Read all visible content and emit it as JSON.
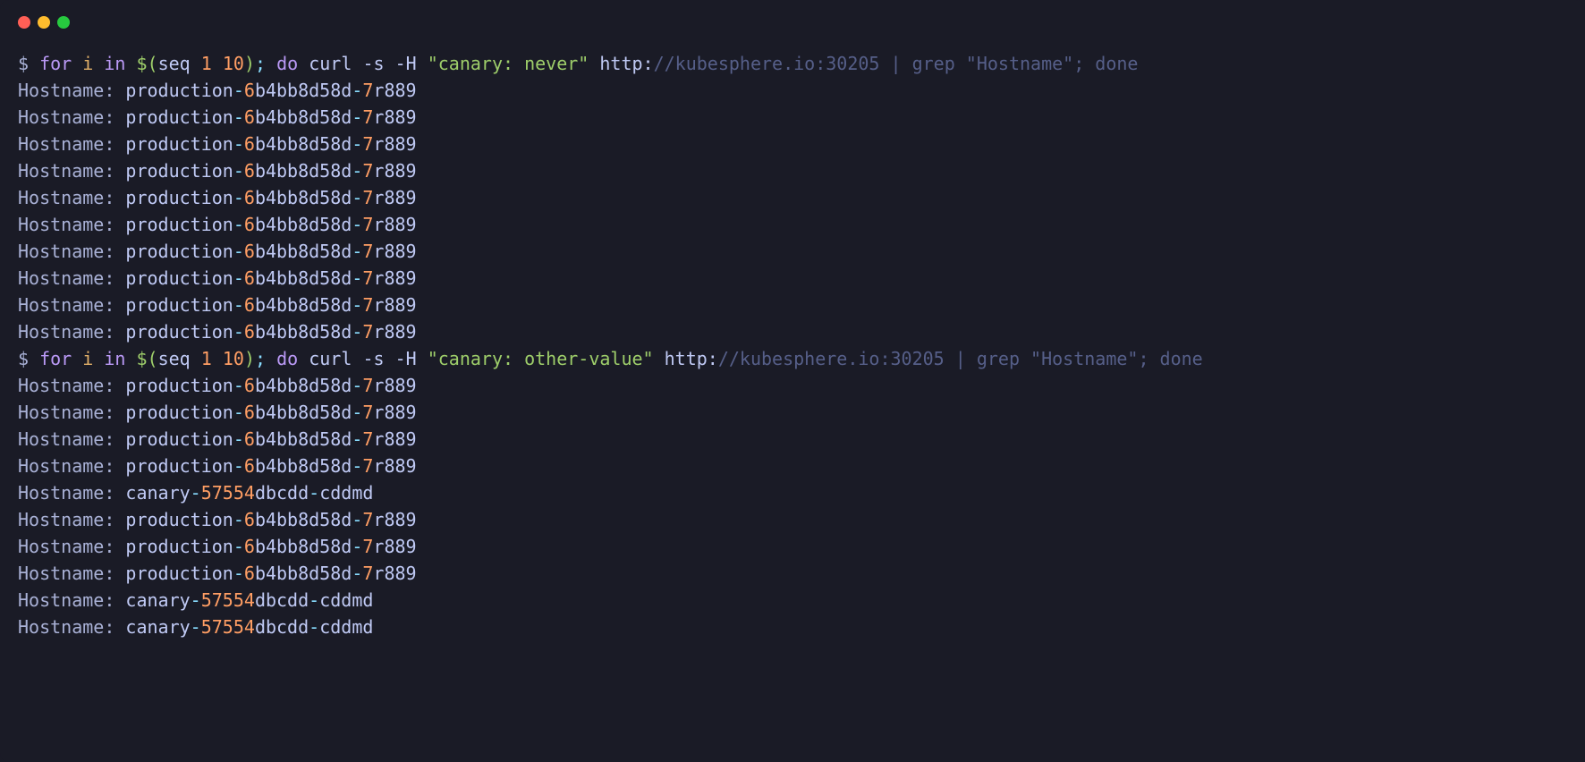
{
  "window": {
    "traffic_lights": [
      "red",
      "yellow",
      "green"
    ]
  },
  "commands": [
    {
      "prompt": "$",
      "tokens": [
        {
          "t": " ",
          "c": "prompt"
        },
        {
          "t": "for",
          "c": "kw-for"
        },
        {
          "t": " ",
          "c": "prompt"
        },
        {
          "t": "i",
          "c": "var-i"
        },
        {
          "t": " ",
          "c": "prompt"
        },
        {
          "t": "in",
          "c": "kw-in"
        },
        {
          "t": " ",
          "c": "prompt"
        },
        {
          "t": "$(",
          "c": "dollar-paren"
        },
        {
          "t": "seq ",
          "c": "cmd"
        },
        {
          "t": "1",
          "c": "num"
        },
        {
          "t": " ",
          "c": "prompt"
        },
        {
          "t": "10",
          "c": "num"
        },
        {
          "t": ")",
          "c": "dollar-paren"
        },
        {
          "t": ";",
          "c": "semi"
        },
        {
          "t": " ",
          "c": "prompt"
        },
        {
          "t": "do",
          "c": "kw-do"
        },
        {
          "t": " curl ",
          "c": "cmd"
        },
        {
          "t": "-s",
          "c": "flag"
        },
        {
          "t": " ",
          "c": "prompt"
        },
        {
          "t": "-H",
          "c": "flag"
        },
        {
          "t": " ",
          "c": "prompt"
        },
        {
          "t": "\"canary: never\"",
          "c": "str"
        },
        {
          "t": " http:",
          "c": "http"
        },
        {
          "t": "//kubesphere.io:30205 | grep \"Hostname\"; done",
          "c": "url-comment"
        }
      ],
      "output": [
        {
          "type": "production"
        },
        {
          "type": "production"
        },
        {
          "type": "production"
        },
        {
          "type": "production"
        },
        {
          "type": "production"
        },
        {
          "type": "production"
        },
        {
          "type": "production"
        },
        {
          "type": "production"
        },
        {
          "type": "production"
        },
        {
          "type": "production"
        }
      ]
    },
    {
      "prompt": "$",
      "tokens": [
        {
          "t": " ",
          "c": "prompt"
        },
        {
          "t": "for",
          "c": "kw-for"
        },
        {
          "t": " ",
          "c": "prompt"
        },
        {
          "t": "i",
          "c": "var-i"
        },
        {
          "t": " ",
          "c": "prompt"
        },
        {
          "t": "in",
          "c": "kw-in"
        },
        {
          "t": " ",
          "c": "prompt"
        },
        {
          "t": "$(",
          "c": "dollar-paren"
        },
        {
          "t": "seq ",
          "c": "cmd"
        },
        {
          "t": "1",
          "c": "num"
        },
        {
          "t": " ",
          "c": "prompt"
        },
        {
          "t": "10",
          "c": "num"
        },
        {
          "t": ")",
          "c": "dollar-paren"
        },
        {
          "t": ";",
          "c": "semi"
        },
        {
          "t": " ",
          "c": "prompt"
        },
        {
          "t": "do",
          "c": "kw-do"
        },
        {
          "t": " curl ",
          "c": "cmd"
        },
        {
          "t": "-s",
          "c": "flag"
        },
        {
          "t": " ",
          "c": "prompt"
        },
        {
          "t": "-H",
          "c": "flag"
        },
        {
          "t": " ",
          "c": "prompt"
        },
        {
          "t": "\"canary: other-value\"",
          "c": "str"
        },
        {
          "t": " http:",
          "c": "http"
        },
        {
          "t": "//kubesphere.io:30205 | grep \"Hostname\"; done",
          "c": "url-comment"
        }
      ],
      "output": [
        {
          "type": "production"
        },
        {
          "type": "production"
        },
        {
          "type": "production"
        },
        {
          "type": "production"
        },
        {
          "type": "canary"
        },
        {
          "type": "production"
        },
        {
          "type": "production"
        },
        {
          "type": "production"
        },
        {
          "type": "canary"
        },
        {
          "type": "canary"
        }
      ]
    }
  ],
  "hostnames": {
    "production": {
      "label": "Hostname: ",
      "parts": [
        {
          "t": "production",
          "c": "out-name"
        },
        {
          "t": "-",
          "c": "out-dash"
        },
        {
          "t": "6",
          "c": "out-num"
        },
        {
          "t": "b4bb8d58d",
          "c": "out-name"
        },
        {
          "t": "-",
          "c": "out-dash"
        },
        {
          "t": "7",
          "c": "out-num"
        },
        {
          "t": "r889",
          "c": "out-name"
        }
      ]
    },
    "canary": {
      "label": "Hostname: ",
      "parts": [
        {
          "t": "canary",
          "c": "out-name"
        },
        {
          "t": "-",
          "c": "out-dash"
        },
        {
          "t": "57554",
          "c": "out-num"
        },
        {
          "t": "dbcdd",
          "c": "out-name"
        },
        {
          "t": "-",
          "c": "out-dash"
        },
        {
          "t": "cddmd",
          "c": "out-name"
        }
      ]
    }
  }
}
